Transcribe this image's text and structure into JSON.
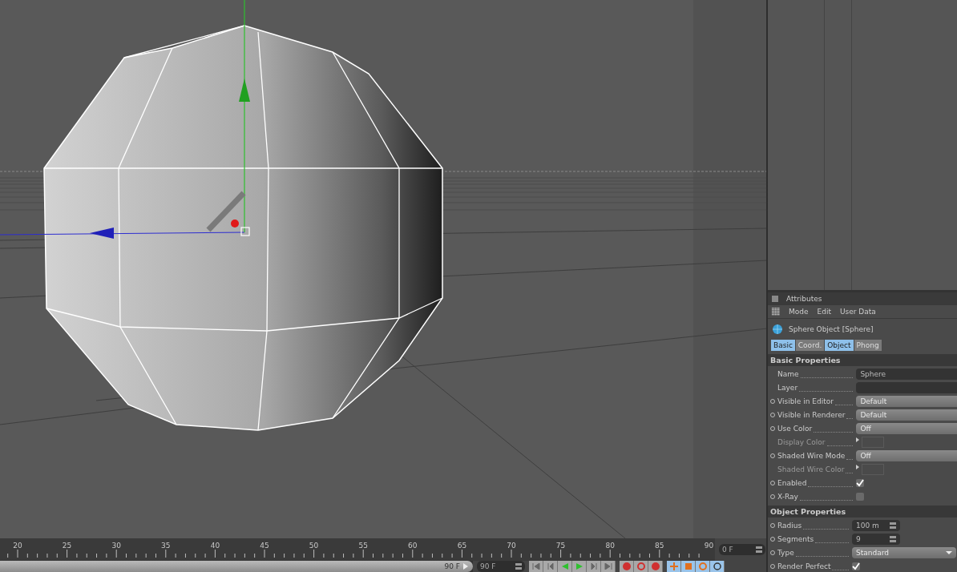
{
  "timeline": {
    "frames": [
      "20",
      "25",
      "30",
      "35",
      "40",
      "45",
      "50",
      "55",
      "60",
      "65",
      "70",
      "75",
      "80",
      "85",
      "90"
    ],
    "current_frame": "0 F",
    "range_slider": {
      "label": "90 F",
      "level": 1
    },
    "end_frame": "90 F"
  },
  "attributes": {
    "title": "Attributes",
    "menu": [
      "Mode",
      "Edit",
      "User Data"
    ],
    "object": "Sphere Object [Sphere]",
    "tabs": [
      {
        "label": "Basic",
        "selected": true
      },
      {
        "label": "Coord.",
        "selected": false
      },
      {
        "label": "Object",
        "selected": true
      },
      {
        "label": "Phong",
        "selected": false
      }
    ],
    "sections": [
      {
        "title": "Basic Properties",
        "rows": [
          {
            "label": "Name",
            "kind": "text",
            "value": "Sphere",
            "animatable": false,
            "disabled": false
          },
          {
            "label": "Layer",
            "kind": "text",
            "animatable": false,
            "disabled": false
          },
          {
            "label": "Visible in Editor",
            "kind": "dropdown",
            "value": "Default",
            "animatable": true,
            "disabled": false
          },
          {
            "label": "Visible in Renderer",
            "kind": "dropdown",
            "value": "Default",
            "animatable": true,
            "disabled": false
          },
          {
            "label": "Use Color",
            "kind": "dropdown",
            "value": "Off",
            "animatable": true,
            "disabled": false
          },
          {
            "label": "Display Color",
            "kind": "color",
            "animatable": false,
            "disabled": true
          },
          {
            "label": "Shaded Wire Mode",
            "kind": "dropdown",
            "value": "Off",
            "animatable": true,
            "disabled": false
          },
          {
            "label": "Shaded Wire Color",
            "kind": "color",
            "animatable": false,
            "disabled": true
          },
          {
            "label": "Enabled",
            "kind": "checkbox",
            "checked": true,
            "animatable": true,
            "disabled": false
          },
          {
            "label": "X-Ray",
            "kind": "checkbox",
            "checked": false,
            "animatable": true,
            "disabled": false
          }
        ]
      },
      {
        "title": "Object Properties",
        "rows": [
          {
            "label": "Radius",
            "kind": "number",
            "value": "100 m",
            "animatable": true,
            "disabled": false
          },
          {
            "label": "Segments",
            "kind": "number",
            "value": "9",
            "animatable": true,
            "disabled": false
          },
          {
            "label": "Type",
            "kind": "select",
            "value": "Standard",
            "animatable": true,
            "disabled": false
          },
          {
            "label": "Render Perfect",
            "kind": "checkbox",
            "checked": true,
            "animatable": true,
            "disabled": false
          }
        ]
      }
    ]
  }
}
